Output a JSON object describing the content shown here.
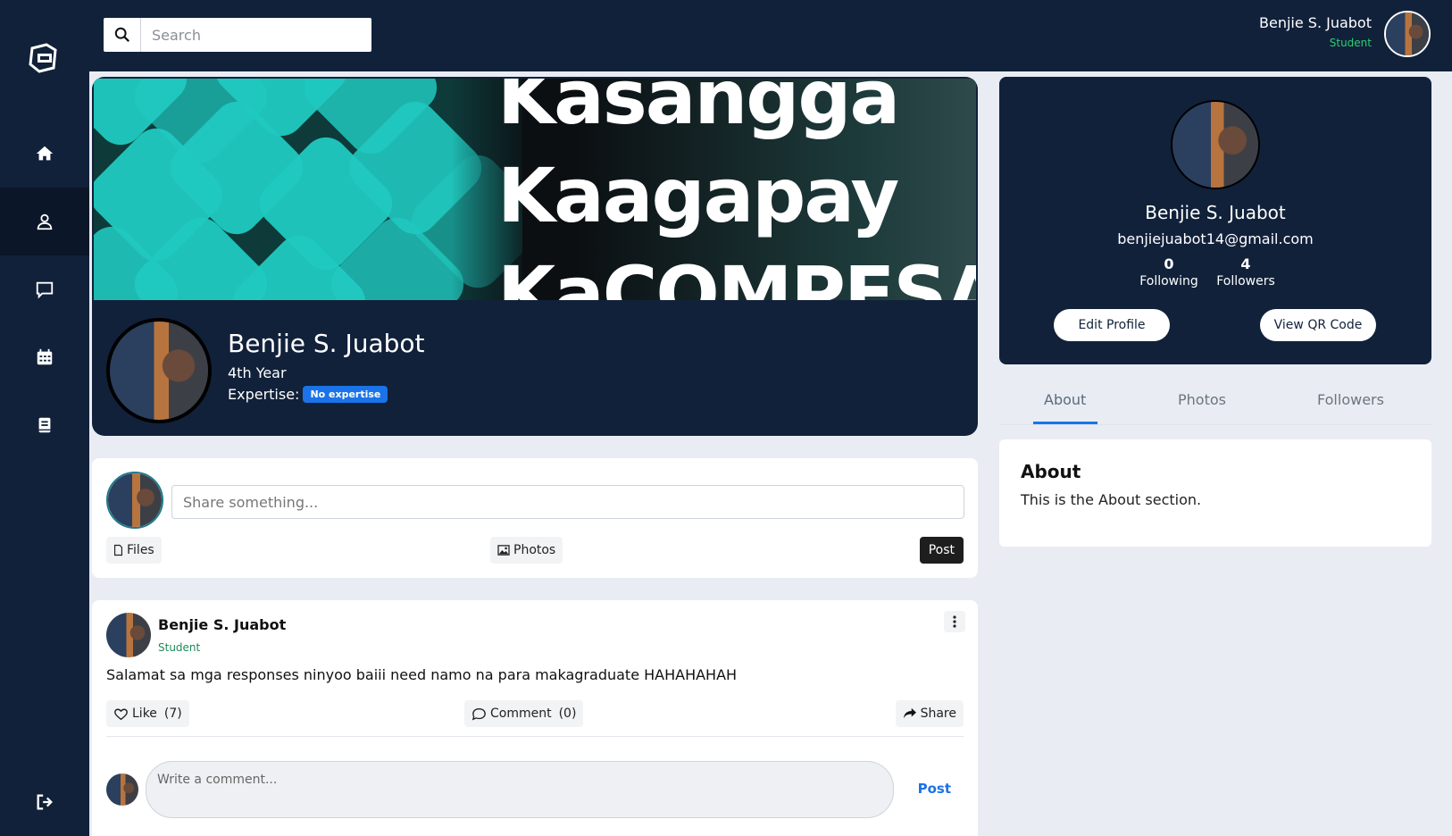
{
  "app": {
    "logo_icon": "app-logo-icon"
  },
  "sidebar": {
    "items": [
      {
        "name": "home",
        "icon": "home-icon"
      },
      {
        "name": "profile",
        "icon": "user-icon",
        "active": true
      },
      {
        "name": "messages",
        "icon": "chat-icon"
      },
      {
        "name": "calendar",
        "icon": "calendar-icon"
      },
      {
        "name": "book",
        "icon": "book-icon"
      }
    ],
    "logout_icon": "logout-icon"
  },
  "header": {
    "search_placeholder": "Search",
    "user_name": "Benjie S. Juabot",
    "user_role": "Student"
  },
  "profile": {
    "banner_lines": [
      "Kasangga",
      "Kaagapay",
      "KaCOMPESA."
    ],
    "name": "Benjie S. Juabot",
    "year": "4th Year",
    "expertise_label": "Expertise:",
    "expertise_badge": "No expertise"
  },
  "composer": {
    "placeholder": "Share something...",
    "files_label": "Files",
    "photos_label": "Photos",
    "post_label": "Post"
  },
  "post": {
    "author": "Benjie S. Juabot",
    "role": "Student",
    "text": "Salamat sa mga responses ninyoo baiii need namo na para makagraduate HAHAHAHAH",
    "like_label": "Like",
    "like_count": "(7)",
    "comment_label": "Comment",
    "comment_count": "(0)",
    "share_label": "Share",
    "comment_placeholder": "Write a comment...",
    "comment_post_label": "Post"
  },
  "side_profile": {
    "name": "Benjie S. Juabot",
    "email": "benjiejuabot14@gmail.com",
    "following_count": "0",
    "following_label": "Following",
    "followers_count": "4",
    "followers_label": "Followers",
    "edit_label": "Edit Profile",
    "qr_label": "View QR Code"
  },
  "tabs": [
    "About",
    "Photos",
    "Followers"
  ],
  "about": {
    "title": "About",
    "text": "This is the About section."
  },
  "colors": {
    "navy": "#11213a",
    "accent_blue": "#1a73e8",
    "student_green": "#2ecc71",
    "banner_teal": "#20c9c0"
  }
}
